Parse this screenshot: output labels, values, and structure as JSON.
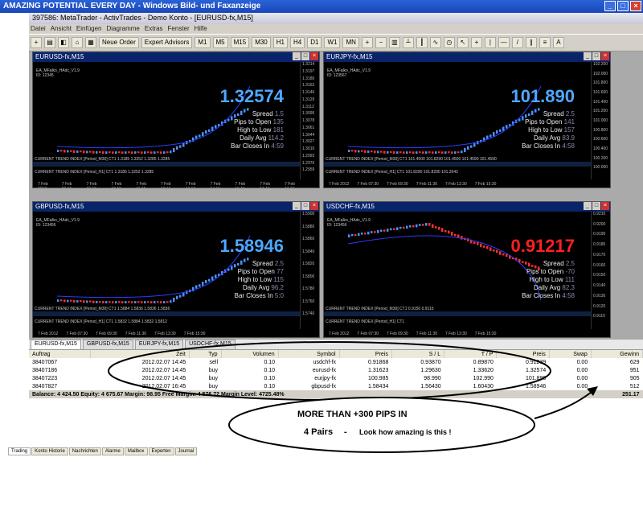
{
  "outer_window": {
    "title": "AMAZING POTENTIAL EVERY DAY - Windows Bild- und Faxanzeige"
  },
  "app": {
    "title": "397586: MetaTrader - ActivTrades - Demo Konto - [EURUSD-fx,M15]",
    "menu": [
      "Datei",
      "Ansicht",
      "Einfügen",
      "Diagramme",
      "Extras",
      "Fenster",
      "Hilfe"
    ],
    "toolbar": {
      "new_order": "Neue Order",
      "expert_advisors": "Expert Advisors",
      "timeframes": [
        "M1",
        "M5",
        "M15",
        "M30",
        "H1",
        "H4",
        "D1",
        "W1",
        "MN"
      ]
    }
  },
  "charts": [
    {
      "title": "EURUSD-fx,M15",
      "ea_title": "EA_MFalko_HAdc_V1.9",
      "id": "ID: 12345",
      "price": "1.32574",
      "price_color": "#4fa8ff",
      "spread": "1.5",
      "pips_to_open": "135",
      "high_to_low": "181",
      "daily_avg": "114.2",
      "bar_closes": "4:59",
      "axis": [
        "1.3214",
        "1.3197",
        "1.3180",
        "1.3163",
        "1.3146",
        "1.3129",
        "1.3112",
        "1.3095",
        "1.3078",
        "1.3061",
        "1.3044",
        "1.3027",
        "1.3010",
        "1.2993",
        "1.2976",
        "1.2959"
      ],
      "xaxis": [
        "7 Feb 2012",
        "7 Feb 08:15",
        "7 Feb 09:15",
        "7 Feb 10:15",
        "7 Feb 11:15",
        "7 Feb 12:15",
        "7 Feb 13:15",
        "7 Feb 14:15",
        "7 Feb 15:15",
        "7 Feb 16:15",
        "7 Feb 17:15"
      ],
      "ind1": "CURRENT TREND INDEX [Period_M30] CT1 1.3185 1.3252 1.3285 1.3285",
      "ind2": "CURRENT TREND INDEX [Period_H1] CT1 1.3185 1.3252 1.3285"
    },
    {
      "title": "EURJPY-fx,M15",
      "ea_title": "EA_MFalko_HAdc_V1.9",
      "id": "ID: 123567",
      "price": "101.890",
      "price_color": "#4fa8ff",
      "spread": "2.5",
      "pips_to_open": "141",
      "high_to_low": "157",
      "daily_avg": "83.9",
      "bar_closes": "4:58",
      "axis": [
        "102.200",
        "102.000",
        "101.800",
        "101.600",
        "101.400",
        "101.200",
        "101.000",
        "100.800",
        "100.600",
        "100.400",
        "100.200",
        "100.000"
      ],
      "xaxis": [
        "7 Feb 2012",
        "7 Feb 07:30",
        "7 Feb 09:30",
        "7 Feb 11:30",
        "7 Feb 13:30",
        "7 Feb 15:30"
      ],
      "ind1": "CURRENT TREND INDEX [Period_M30] CT1 101.4500 101.8290 101.4500 101.4590 101.4590",
      "ind2": "CURRENT TREND INDEX [Period_H1] CT1 101.8290 101.8290 101.2642"
    },
    {
      "title": "GBPUSD-fx,M15",
      "ea_title": "EA_MFalko_HAdc_V1.9",
      "id": "ID: 123456",
      "price": "1.58946",
      "price_color": "#4fa8ff",
      "spread": "2.5",
      "pips_to_open": "77",
      "high_to_low": "115",
      "daily_avg": "96.2",
      "bar_closes": "5:0",
      "axis": [
        "1.5900",
        "1.5880",
        "1.5860",
        "1.5840",
        "1.5820",
        "1.5800",
        "1.5780",
        "1.5760",
        "1.5740"
      ],
      "xaxis": [
        "7 Feb 2012",
        "7 Feb 07:30",
        "7 Feb 09:30",
        "7 Feb 11:30",
        "7 Feb 13:30",
        "7 Feb 15:30"
      ],
      "ind1": "CURRENT TREND INDEX [Period_M30] CT1 1.5884 1.5836 1.5836 1.5836",
      "ind2": "CURRENT TREND INDEX [Period_H1] CT1 1.5832 1.5884 1.5832 1.5812"
    },
    {
      "title": "USDCHF-fx,M15",
      "ea_title": "EA_MFalko_HAdc_V1.9",
      "id": "ID: 123456",
      "price": "0.91217",
      "price_color": "#ff2020",
      "spread": "2.5",
      "pips_to_open": "-70",
      "high_to_low": "111",
      "daily_avg": "82.3",
      "bar_closes": "4:58",
      "axis": [
        "0.9210",
        "0.9200",
        "0.9190",
        "0.9180",
        "0.9170",
        "0.9160",
        "0.9150",
        "0.9140",
        "0.9130",
        "0.9120",
        "0.9110"
      ],
      "xaxis": [
        "7 Feb 2012",
        "7 Feb 07:30",
        "7 Feb 09:30",
        "7 Feb 11:30",
        "7 Feb 13:30",
        "7 Feb 15:30"
      ],
      "ind1": "CURRENT TREND INDEX [Period_M30] CT1 0.9150 0.9115",
      "ind2": "CURRENT TREND INDEX [Period_H1] CT1"
    }
  ],
  "chart_tabs": [
    "EURUSD-fx,M15",
    "GBPUSD-fx,M15",
    "EURJPY-fx,M15",
    "USDCHF-fx,M15"
  ],
  "terminal": {
    "headers": [
      "Auftrag",
      "Zeit",
      "Typ",
      "Volumen",
      "Symbol",
      "Preis",
      "S / L",
      "T / P",
      "Preis",
      "Swap",
      "Gewinn"
    ],
    "rows": [
      [
        "38407067",
        "2012.02.07 14:45",
        "sell",
        "0.10",
        "usdchf-fx",
        "0.91868",
        "0.93870",
        "0.89870",
        "0.91239",
        "0.00",
        "629"
      ],
      [
        "38407186",
        "2012.02.07 14:45",
        "buy",
        "0.10",
        "eurusd-fx",
        "1.31623",
        "1.29630",
        "1.33620",
        "1.32574",
        "0.00",
        "951"
      ],
      [
        "38407223",
        "2012.02.07 14:45",
        "buy",
        "0.10",
        "eurjpy-fx",
        "100.985",
        "98.990",
        "102.990",
        "101.890",
        "0.00",
        "905"
      ],
      [
        "38407827",
        "2012.02.07 16:45",
        "buy",
        "0.10",
        "gbpusd-fx",
        "1.58434",
        "1.56430",
        "1.60430",
        "1.58946",
        "0.00",
        "512"
      ]
    ],
    "balance_line": "Balance: 4 424.50  Equity: 4 675.67  Margin: 98.95  Free Margin: 4 576.72  Margin Level: 4725.48%",
    "total": "251.17",
    "bottom_tabs": [
      "Trading",
      "Konto Historie",
      "Nachrichten",
      "Alarme",
      "Mailbox",
      "Experten",
      "Journal"
    ]
  },
  "annotation": {
    "line1": "MORE THAN  +300 PIPS IN",
    "line2_a": "4  Pairs",
    "line2_b": "-",
    "line2_c": "Look how amazing is this  !"
  }
}
